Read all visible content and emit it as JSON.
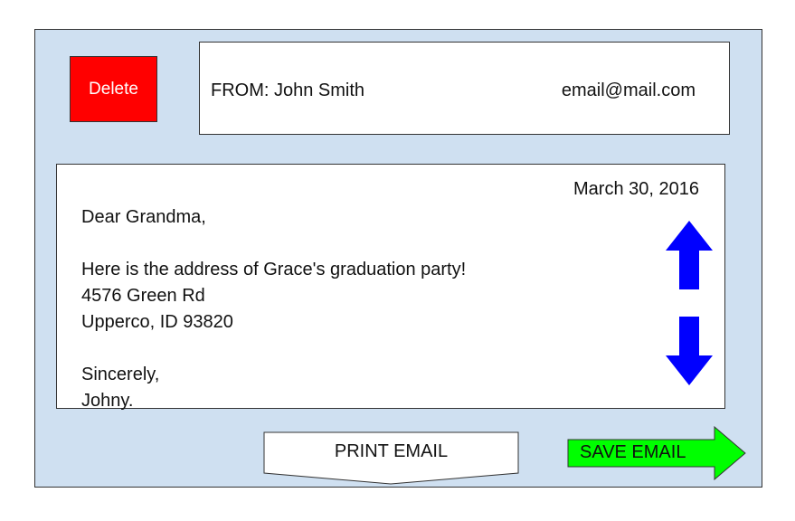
{
  "actions": {
    "delete_label": "Delete"
  },
  "header": {
    "from_label": "FROM: John Smith",
    "email": "email@mail.com"
  },
  "message": {
    "date": "March 30, 2016",
    "greeting": "Dear Grandma,",
    "line1": "Here is the address of Grace's graduation party!",
    "line2": "4576 Green Rd",
    "line3": "Upperco, ID 93820",
    "closing": "Sincerely,",
    "signature": "Johny."
  },
  "footer": {
    "print_label": "PRINT EMAIL",
    "save_label": "SAVE EMAIL"
  },
  "colors": {
    "frame_bg": "#cfe0f1",
    "delete_bg": "#ff0000",
    "scroll_arrow": "#0000ff",
    "save_bg": "#00ff00"
  },
  "icons": {
    "scroll_up": "arrow-up-icon",
    "scroll_down": "arrow-down-icon"
  }
}
